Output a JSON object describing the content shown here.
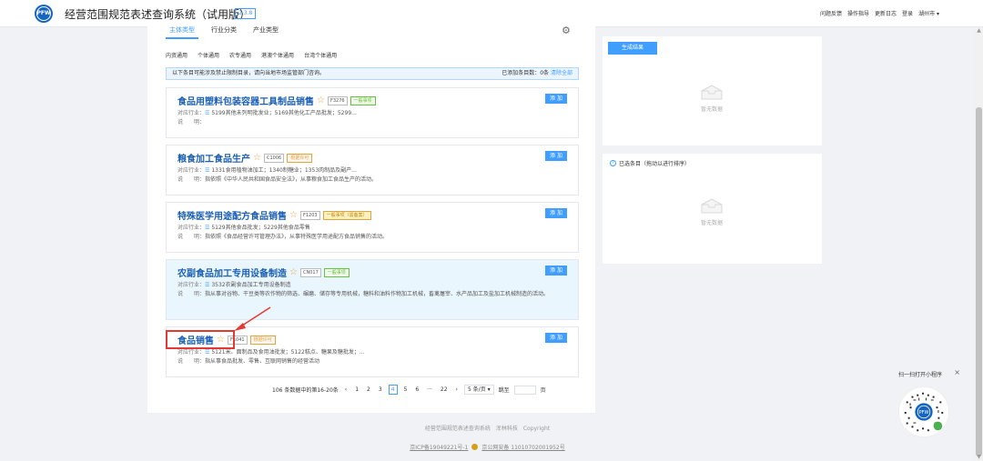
{
  "header": {
    "logo_text": "PFW",
    "title": "经营范围规范表述查询系统（试用版）",
    "version": "2.3.8",
    "nav": [
      "问题反馈",
      "操作指导",
      "更新日志",
      "登录"
    ],
    "city": "湖州市"
  },
  "tabs": [
    {
      "label": "主体类型",
      "active": true
    },
    {
      "label": "行业分类",
      "active": false
    },
    {
      "label": "产业类型",
      "active": false
    }
  ],
  "subtabs": [
    "内资通用",
    "个体通用",
    "农专通用",
    "港澳个体通用",
    "台湾个体通用"
  ],
  "info_bar": {
    "text": "以下条目可能涉及禁止限制目录，请向当地市场监管部门咨询。",
    "count_text": "已添加条目数：0条",
    "clear_label": "清除全部"
  },
  "cards": [
    {
      "title": "食品用塑料包装容器工具制品销售",
      "code": "F3276",
      "tag": "一般事项",
      "tag_color": "green",
      "industry_label": "对应行业：",
      "industry": "5199其他未列明批发业；5169其他化工产品批发；5299...",
      "desc_label": "说　　明：",
      "desc": "",
      "add_label": "添 加"
    },
    {
      "title": "粮食加工食品生产",
      "code": "C1006",
      "tag": "根据许可",
      "tag_color": "orange",
      "industry_label": "对应行业：",
      "industry": "1331食用植物油加工；1340制糖业；1353肉制品及副产...",
      "desc_label": "说　　明：",
      "desc": "指依照《中华人民共和国食品安全法》，从事粮食加工食品生产的活动。",
      "add_label": "添 加"
    },
    {
      "title": "特殊医学用途配方食品销售",
      "code": "F1203",
      "tag": "一般事项（需备案）",
      "tag_color": "yellow",
      "industry_label": "对应行业：",
      "industry": "5129其他食品批发；5229其他食品零售",
      "desc_label": "说　　明：",
      "desc": "指依照《食品经营许可管理办法》，从事特殊医学用途配方食品销售的活动。",
      "add_label": "添 加"
    },
    {
      "title": "农副食品加工专用设备制造",
      "code": "CN017",
      "tag": "一般事项",
      "tag_color": "green",
      "industry_label": "对应行业：",
      "industry": "3532农副食品加工专用设备制造",
      "desc_label": "说　　明：",
      "desc": "指从事对谷物、干豆类等农作物的筛选、碾磨、储存等专用机械，糖料和油料作物加工机械，畜禽屠宰、水产品加工及盐加工机械制造的活动。",
      "add_label": "添 加"
    },
    {
      "title": "食品销售",
      "code": "F1041",
      "tag": "根据许可",
      "tag_color": "orange",
      "industry_label": "对应行业：",
      "industry": "5121米、面制品及食用油批发；5122糕点、糖果及糖批发；...",
      "desc_label": "说　　明：",
      "desc": "指从事食品批发、零售、互联网销售的经营活动",
      "add_label": "添 加"
    }
  ],
  "pager": {
    "summary": "106 条数据中的第16-20条",
    "pages": [
      "1",
      "2",
      "3",
      "4",
      "5",
      "6",
      "···",
      "22"
    ],
    "current": "4",
    "page_size": "5 条/页",
    "jump_label": "跳至",
    "jump_suffix": "页"
  },
  "side": {
    "generate_label": "生成结果",
    "empty_text": "暂无数据",
    "selected_label": "已选条目（拖动以进行排序）",
    "empty_text_2": "暂无数据"
  },
  "footer": {
    "line1": "经营范围规范表述查询系统　浑林科技　Copyright",
    "icp": "京ICP备19049221号-1",
    "police": "京公网安备 11010702001952号"
  },
  "qr": {
    "title": "扫一扫打开小程序",
    "close": "×"
  },
  "colors": {
    "accent": "#409eff",
    "highlight_red": "#e53935",
    "title_blue": "#1a5fb4"
  }
}
